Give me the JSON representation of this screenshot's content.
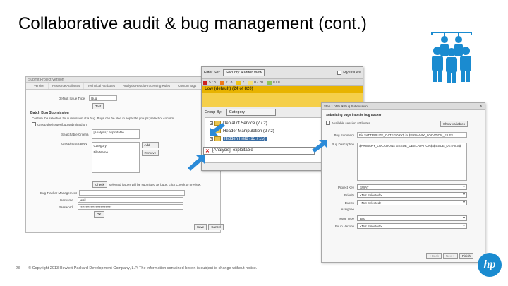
{
  "slide": {
    "title": "Collaborative audit & bug management (cont.)",
    "page_number": "23",
    "footer": "© Copyright 2013 Hewlett-Packard Development Company, L.P. The information contained herein is subject to change without notice.",
    "logo_text": "hp"
  },
  "win1": {
    "title": "Submit Project Version",
    "tabs": [
      "Version",
      "Resource Attributes",
      "Technical Attributes",
      "Analysis Result Processing Rules",
      "Custom Tags",
      "Bug"
    ],
    "default_issue_type_label": "Default Issue Type",
    "default_issue_type_value": "Bug",
    "test_button": "Test",
    "section": "Batch Bug Submission",
    "section_desc": "Confirm the selection for submission of a bug. Bugs can be filed in separate groups; select or confirm.",
    "group_label": "Group the issues/bug submitted on",
    "filter_label": "Searchable Criteria",
    "filter_value": "[Analysis]: exploitable",
    "grouping_label": "Grouping Strategy",
    "grouping_items": [
      "Category",
      "File Name"
    ],
    "add_button": "Add",
    "remove_button": "Remove",
    "check_button": "Check",
    "check_desc": "selected issues will be submitted as bugs; click Check to preview.",
    "bugtracker_label": "Bug Tracker Management",
    "username_label": "Username",
    "username_value": "jwall",
    "password_label": "Password",
    "password_value": "**************************",
    "ok_button": "OK",
    "save_button": "Save",
    "cancel_button": "Cancel"
  },
  "win2": {
    "filter_label": "Filter Set:",
    "filter_value": "Security Auditor View",
    "my_issues": "My Issues",
    "priorities": [
      {
        "label": "5 / 8",
        "color": "#cc2222"
      },
      {
        "label": "2 / 8",
        "color": "#ee7a1a"
      },
      {
        "label": "7",
        "color": "#f0c419"
      },
      {
        "label": "0 / 20",
        "color": "#f5e07a"
      },
      {
        "label": "0 / 0",
        "color": "#8fc45a"
      }
    ],
    "low_label": "Low (default) (24 of 820)",
    "group_by_label": "Group By:",
    "group_by_value": "Category",
    "tree": [
      {
        "label": "Denial of Service",
        "count": "(7 / 2)"
      },
      {
        "label": "Header Manipulation",
        "count": "(2 / 2)"
      },
      {
        "label": "Hidden Field",
        "count": "(15 / 15)"
      }
    ]
  },
  "search": {
    "value": "[Analysis]: exploitable"
  },
  "win3": {
    "title": "Step 1 of Bulk Bug Submission",
    "submitting": "Submitting bugs into the bug tracker",
    "available_label": "Available session attributes",
    "show_variables": "Show Variables",
    "bug_summary_label": "Bug Summary",
    "bug_summary_value": "Fix $ATTRIBUTE_CATEGORY$ in $PRIMARY_LOCATION_FILE$",
    "bug_description_label": "Bug Description",
    "bug_description_value": "$PRIMARY_LOCATION$ $ISSUE_DESCRIPTION$ $ISSUE_DETAILS$",
    "fields": [
      {
        "label": "Project Key",
        "value": "SWAT"
      },
      {
        "label": "Priority",
        "value": "<Not Selected>"
      },
      {
        "label": "Due In",
        "value": "<Not Selected>"
      },
      {
        "label": "Assignee",
        "value": ""
      },
      {
        "label": "Issue Type",
        "value": "Bug"
      },
      {
        "label": "Fix in Version",
        "value": "<Not Selected>"
      }
    ],
    "back_button": "< Back",
    "next_button": "Next >",
    "finish_button": "Finish"
  },
  "colors": {
    "arrow": "#2a8ad8",
    "people": "#1a8bd0",
    "hp_blue": "#1a8bd0"
  }
}
